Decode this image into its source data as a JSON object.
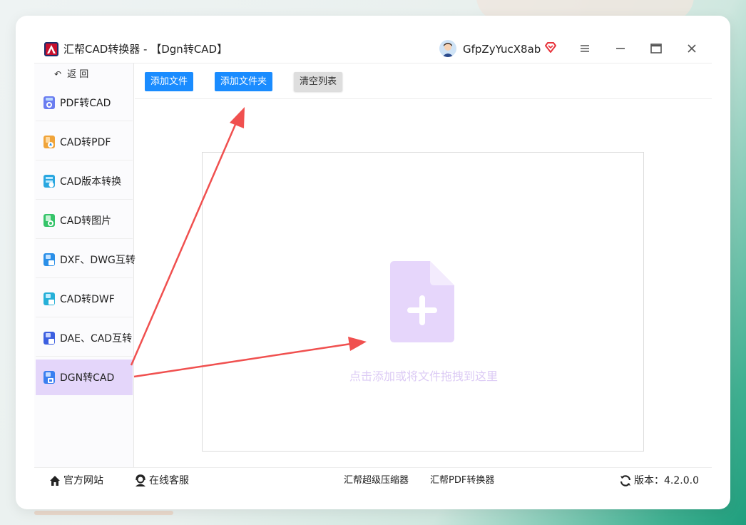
{
  "app": {
    "title": "汇帮CAD转换器 - 【Dgn转CAD】",
    "username": "GfpZyYucX8ab"
  },
  "sidebar": {
    "back_label": "返 回",
    "items": [
      {
        "label": "PDF转CAD",
        "icon": "pdf-to-cad-icon",
        "color": "#6a7cf0"
      },
      {
        "label": "CAD转PDF",
        "icon": "cad-to-pdf-icon",
        "color": "#f0a43a"
      },
      {
        "label": "CAD版本转换",
        "icon": "cad-version-icon",
        "color": "#2aa7e0"
      },
      {
        "label": "CAD转图片",
        "icon": "cad-to-image-icon",
        "color": "#36c46a"
      },
      {
        "label": "DXF、DWG互转",
        "icon": "dxf-dwg-icon",
        "color": "#2a8fe8"
      },
      {
        "label": "CAD转DWF",
        "icon": "cad-to-dwf-icon",
        "color": "#26b0d8"
      },
      {
        "label": "DAE、CAD互转",
        "icon": "dae-cad-icon",
        "color": "#3c5fe0"
      },
      {
        "label": "DGN转CAD",
        "icon": "dgn-to-cad-icon",
        "color": "#3a7ff0"
      }
    ],
    "active_index": 7
  },
  "toolbar": {
    "add_file": "添加文件",
    "add_folder": "添加文件夹",
    "clear_list": "清空列表"
  },
  "dropzone": {
    "hint": "点击添加或将文件拖拽到这里",
    "icon": "file-add-icon"
  },
  "footer": {
    "website": "官方网站",
    "support": "在线客服",
    "compressor": "汇帮超级压缩器",
    "pdf_converter": "汇帮PDF转换器",
    "version": "版本：4.2.0.0"
  },
  "colors": {
    "primary": "#1a8cff",
    "active_nav": "#e4d6fa",
    "drop_icon": "#e6d6fb",
    "annotation_arrow": "#f0504f"
  }
}
